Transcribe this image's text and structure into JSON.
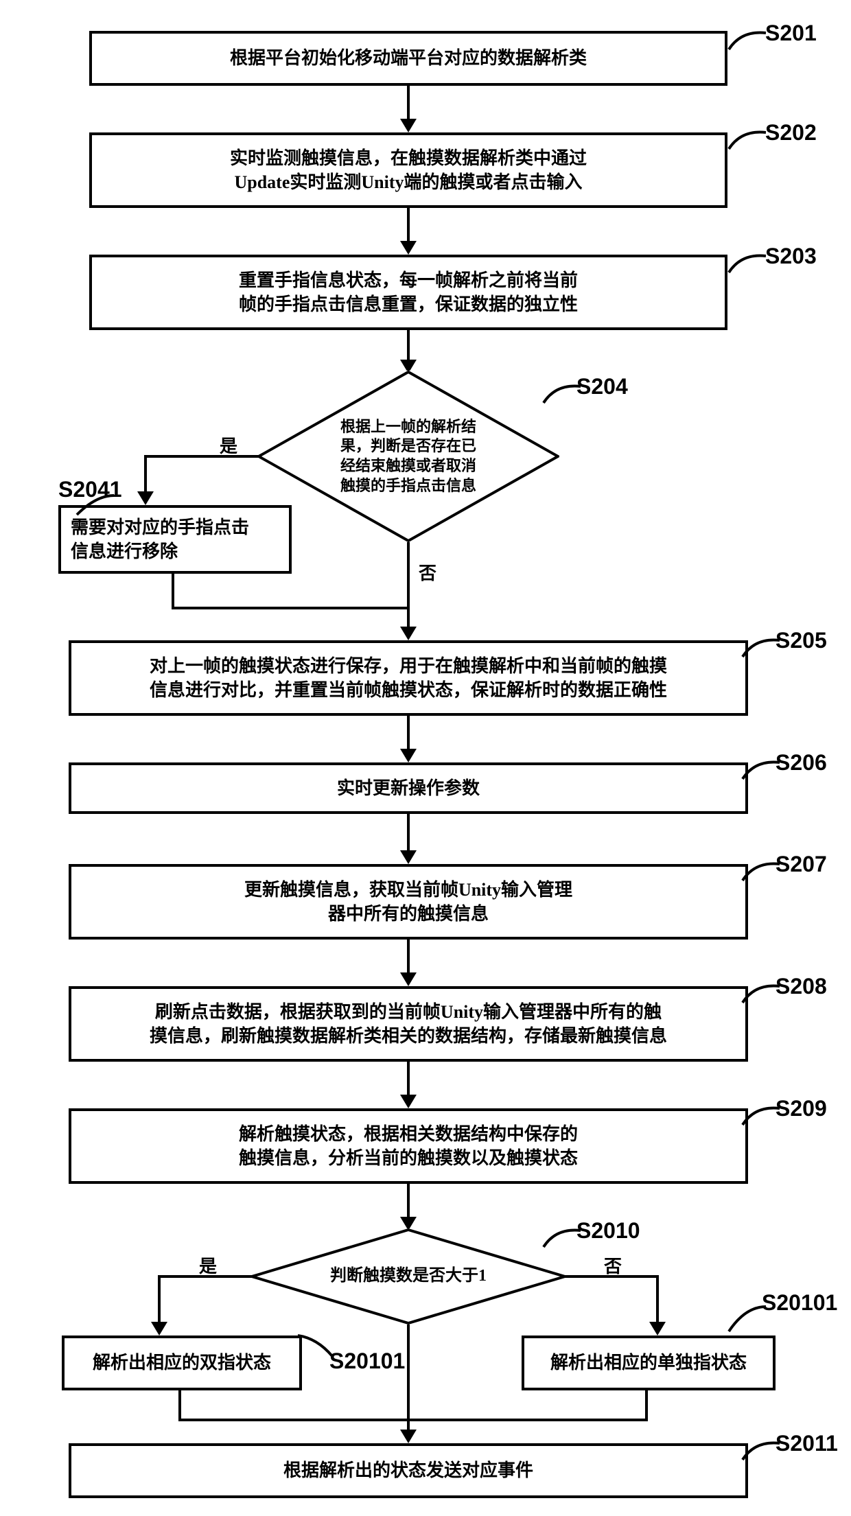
{
  "steps": {
    "s201": {
      "label": "S201",
      "text": "根据平台初始化移动端平台对应的数据解析类"
    },
    "s202": {
      "label": "S202",
      "text": "实时监测触摸信息，在触摸数据解析类中通过\nUpdate实时监测Unity端的触摸或者点击输入"
    },
    "s203": {
      "label": "S203",
      "text": "重置手指信息状态，每一帧解析之前将当前\n帧的手指点击信息重置，保证数据的独立性"
    },
    "s204": {
      "label": "S204",
      "text": "根据上一帧的解析结\n果，判断是否存在已\n经结束触摸或者取消\n触摸的手指点击信息"
    },
    "s2041": {
      "label": "S2041",
      "text": "需要对对应的手指点击\n信息进行移除"
    },
    "s205": {
      "label": "S205",
      "text": "对上一帧的触摸状态进行保存，用于在触摸解析中和当前帧的触摸\n信息进行对比，并重置当前帧触摸状态，保证解析时的数据正确性"
    },
    "s206": {
      "label": "S206",
      "text": "实时更新操作参数"
    },
    "s207": {
      "label": "S207",
      "text": "更新触摸信息，获取当前帧Unity输入管理\n器中所有的触摸信息"
    },
    "s208": {
      "label": "S208",
      "text": "刷新点击数据，根据获取到的当前帧Unity输入管理器中所有的触\n摸信息，刷新触摸数据解析类相关的数据结构，存储最新触摸信息"
    },
    "s209": {
      "label": "S209",
      "text": "解析触摸状态，根据相关数据结构中保存的\n触摸信息，分析当前的触摸数以及触摸状态"
    },
    "s2010": {
      "label": "S2010",
      "text": "判断触摸数是否大于1"
    },
    "s20101l": {
      "label": "S20101",
      "text": "解析出相应的双指状态"
    },
    "s20101r": {
      "label": "S20101",
      "text": "解析出相应的单独指状态"
    },
    "s2011": {
      "label": "S2011",
      "text": "根据解析出的状态发送对应事件"
    }
  },
  "branches": {
    "yes": "是",
    "no": "否"
  }
}
